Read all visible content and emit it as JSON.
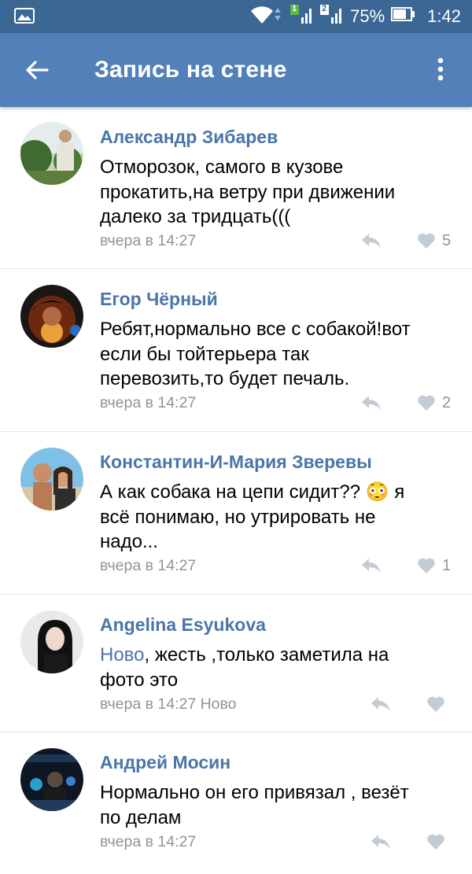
{
  "status_bar": {
    "battery": "75%",
    "time": "1:42",
    "sim1": "1",
    "sim2": "2"
  },
  "app_bar": {
    "title": "Запись на стене"
  },
  "comments": [
    {
      "name": "Александр Зибарев",
      "text_lines": [
        "Отморозок, самого в кузове",
        "прокатить,на ветру при движении",
        "далеко за тридцать((("
      ],
      "time": "вчера в 14:27",
      "likes": "5"
    },
    {
      "name": "Егор Чёрный",
      "text_lines": [
        "Ребят,нормально все с собакой!вот",
        "если бы тойтерьера так",
        "перевозить,то будет печаль."
      ],
      "time": "вчера в 14:27",
      "likes": "2"
    },
    {
      "name": "Константин-И-Мария Зверевы",
      "text_lines": [
        "А как собака на цепи сидит?? 😳 я",
        "всё понимаю, но утрировать не",
        "надо..."
      ],
      "time": "вчера в 14:27",
      "likes": "1"
    },
    {
      "name": "Angelina Esyukova",
      "reply_to": "Ново",
      "text_lines": [
        ", жесть ,только заметила на",
        "фото это"
      ],
      "time": "вчера в 14:27 Ново",
      "likes": ""
    },
    {
      "name": "Андрей Мосин",
      "text_lines": [
        "Нормально он его привязал , везёт",
        "по делам"
      ],
      "time": "вчера в 14:27",
      "likes": ""
    }
  ],
  "colors": {
    "status_bar": "#3c6693",
    "app_bar": "#5181b8",
    "link": "#4a76a8",
    "meta": "#939393",
    "icon": "#c3cbd4"
  }
}
